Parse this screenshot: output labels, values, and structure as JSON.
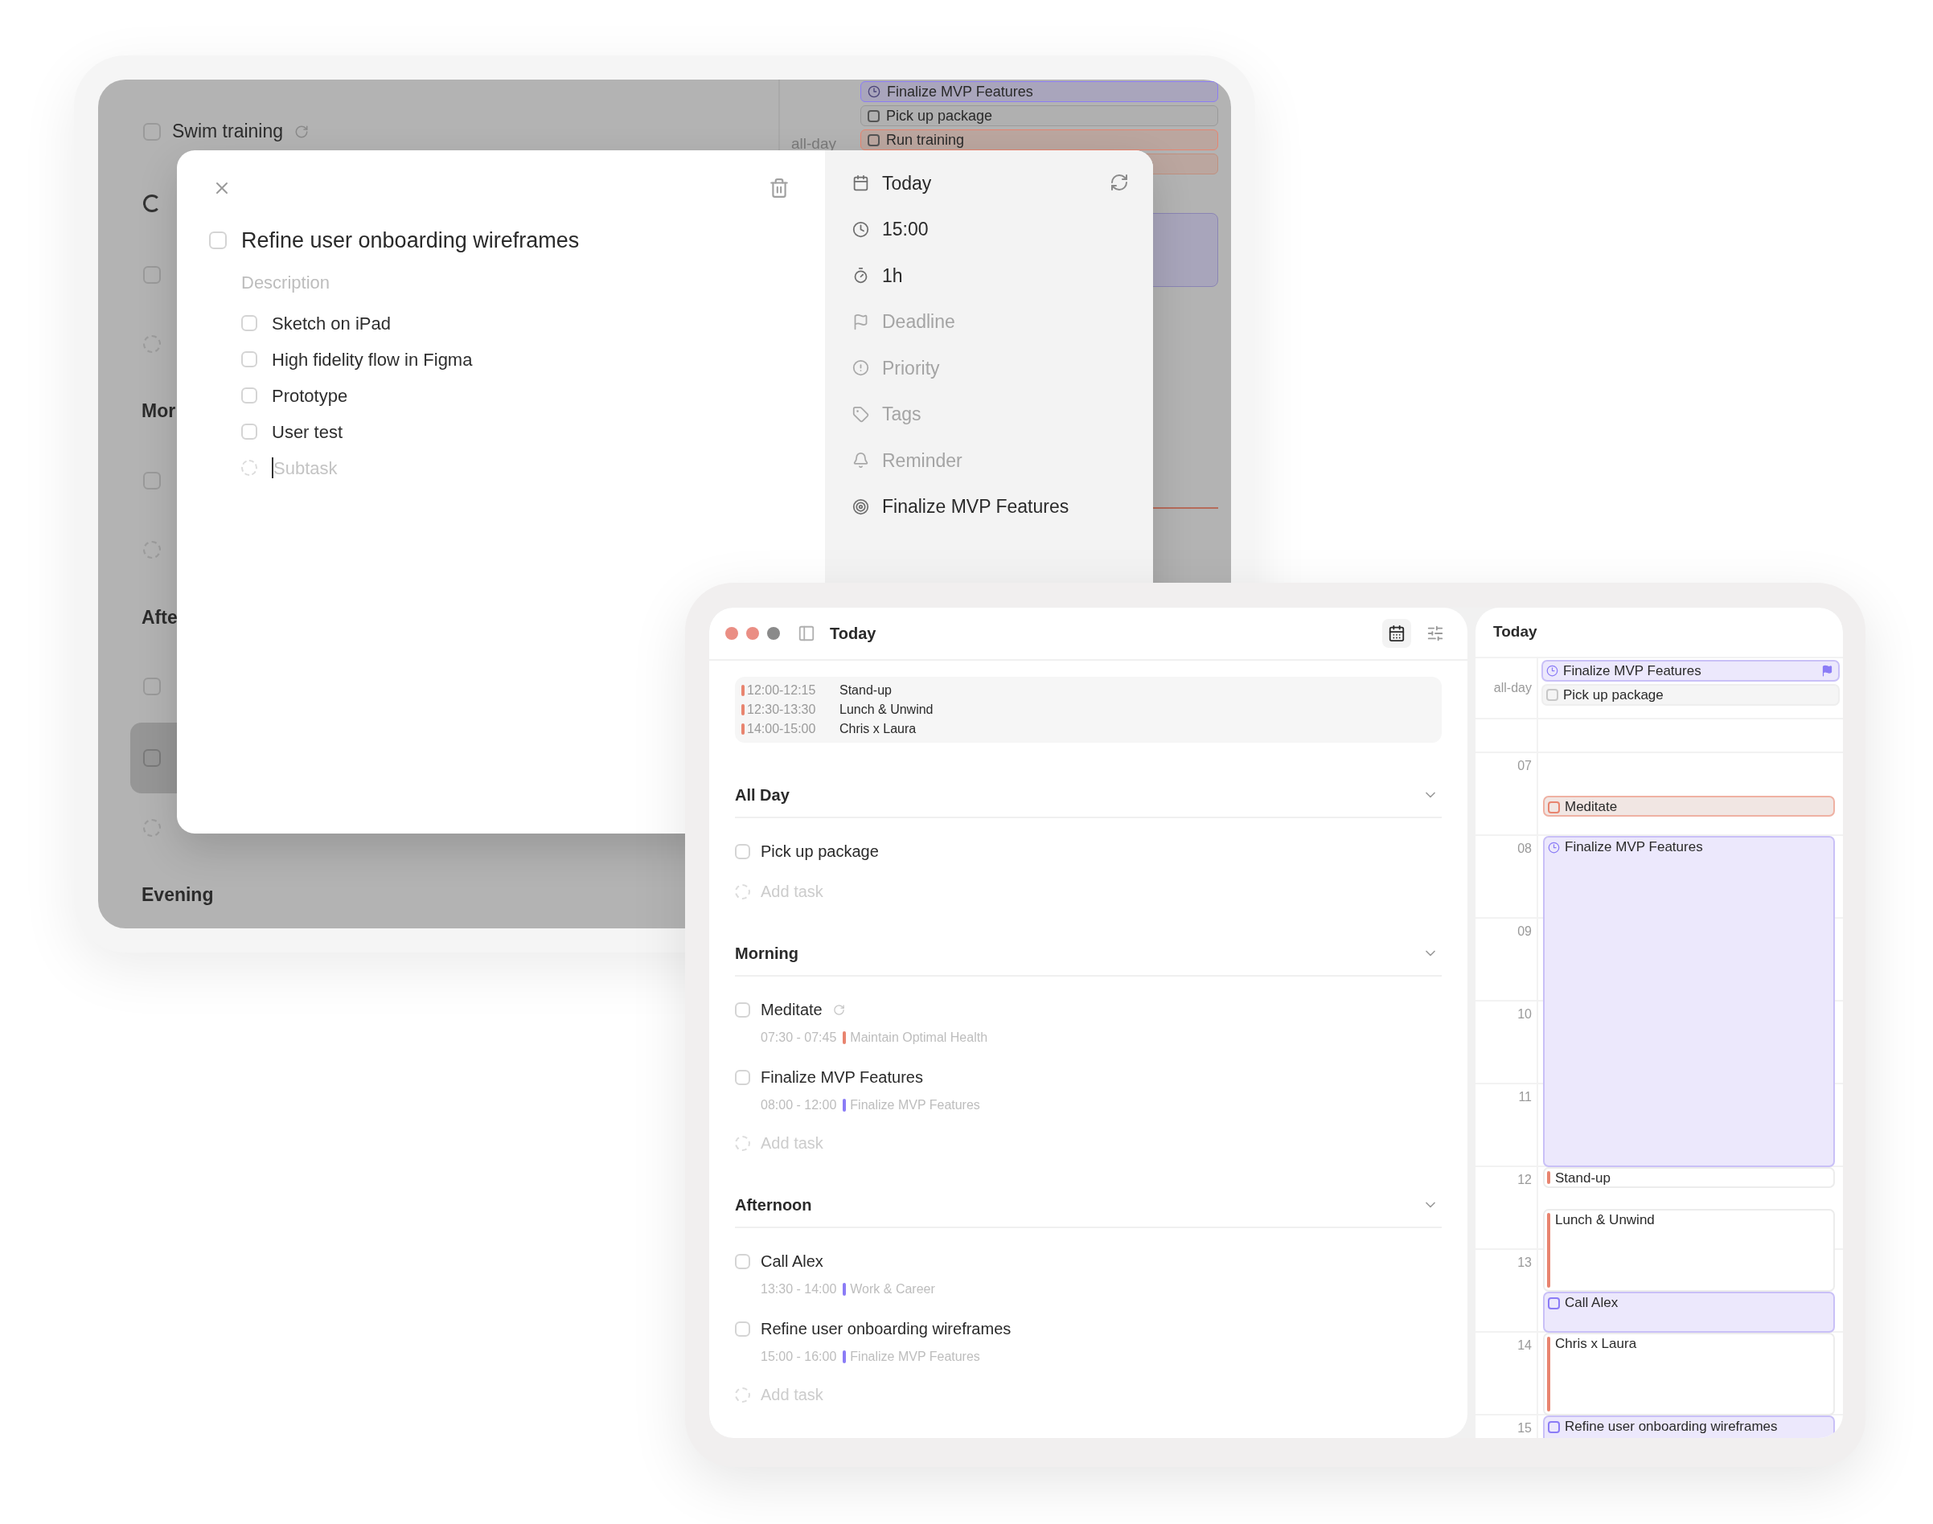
{
  "back_window": {
    "list": [
      {
        "kind": "task",
        "title": "Swim training",
        "checked": false,
        "selected": false
      },
      {
        "kind": "progress"
      },
      {
        "kind": "task",
        "checked": false,
        "selected": false
      },
      {
        "kind": "add"
      },
      {
        "kind": "heading",
        "title": "Mor"
      },
      {
        "kind": "task",
        "checked": false,
        "selected": false
      },
      {
        "kind": "add"
      },
      {
        "kind": "heading",
        "title": "Afte"
      },
      {
        "kind": "task",
        "checked": false,
        "selected": false
      },
      {
        "kind": "task",
        "checked": false,
        "selected": true
      },
      {
        "kind": "add"
      },
      {
        "kind": "heading",
        "title": "Evening"
      }
    ],
    "calendar": {
      "all_day_label": "all-day",
      "events": [
        {
          "kind": "goal",
          "title": "Finalize MVP Features",
          "color": "#8b7cf6"
        },
        {
          "kind": "task",
          "title": "Pick up package",
          "color": "#9a9a9a"
        },
        {
          "kind": "habit",
          "title": "Run training",
          "color": "#e8846f"
        }
      ]
    }
  },
  "task_dialog": {
    "title": "Refine user onboarding wireframes",
    "checked": false,
    "description_placeholder": "Description",
    "subtasks": [
      {
        "title": "Sketch on iPad",
        "checked": false
      },
      {
        "title": "High fidelity flow in Figma",
        "checked": false
      },
      {
        "title": "Prototype",
        "checked": false
      },
      {
        "title": "User test",
        "checked": false
      }
    ],
    "subtask_placeholder": "Subtask",
    "properties": [
      {
        "kind": "date",
        "label": "Today",
        "set": true
      },
      {
        "kind": "time",
        "label": "15:00",
        "set": true
      },
      {
        "kind": "duration",
        "label": "1h",
        "set": true
      },
      {
        "kind": "deadline",
        "label": "Deadline",
        "set": false
      },
      {
        "kind": "priority",
        "label": "Priority",
        "set": false
      },
      {
        "kind": "tags",
        "label": "Tags",
        "set": false
      },
      {
        "kind": "reminder",
        "label": "Reminder",
        "set": false
      },
      {
        "kind": "goal",
        "label": "Finalize MVP Features",
        "set": true
      }
    ]
  },
  "front_window": {
    "title": "Today",
    "calendar_view_selected": true,
    "schedule": [
      {
        "time": "12:00-12:15",
        "title": "Stand-up",
        "color": "#e8846f"
      },
      {
        "time": "12:30-13:30",
        "title": "Lunch & Unwind",
        "color": "#e8846f"
      },
      {
        "time": "14:00-15:00",
        "title": "Chris x Laura",
        "color": "#e8846f"
      }
    ],
    "sections": [
      {
        "title": "All Day",
        "expanded": true,
        "tasks": [
          {
            "title": "Pick up package",
            "checked": false
          }
        ],
        "add_placeholder": "Add task"
      },
      {
        "title": "Morning",
        "expanded": true,
        "tasks": [
          {
            "title": "Meditate",
            "checked": false,
            "repeat": true,
            "time": "07:30 - 07:45",
            "goal": "Maintain Optimal Health",
            "color": "#e8846f"
          },
          {
            "title": "Finalize MVP Features",
            "checked": false,
            "repeat": false,
            "time": "08:00 - 12:00",
            "goal": "Finalize MVP Features",
            "color": "#8b7cf6"
          }
        ],
        "add_placeholder": "Add task"
      },
      {
        "title": "Afternoon",
        "expanded": true,
        "tasks": [
          {
            "title": "Call Alex",
            "checked": false,
            "repeat": false,
            "time": "13:30 - 14:00",
            "goal": "Work & Career",
            "color": "#8b7cf6"
          },
          {
            "title": "Refine user onboarding wireframes",
            "checked": false,
            "repeat": false,
            "time": "15:00 - 16:00",
            "goal": "Finalize MVP Features",
            "color": "#8b7cf6"
          }
        ],
        "add_placeholder": "Add task"
      }
    ],
    "calendar": {
      "title": "Today",
      "all_day_label": "all-day",
      "all_day": [
        {
          "kind": "goal",
          "title": "Finalize MVP Features",
          "color": "#8b7cf6",
          "flagged": true
        },
        {
          "kind": "task",
          "title": "Pick up package",
          "color": "#c8c8c8",
          "flagged": false
        }
      ],
      "hours": [
        "07",
        "08",
        "09",
        "10",
        "11",
        "12",
        "13",
        "14",
        "15"
      ],
      "events": [
        {
          "kind": "habit",
          "title": "Meditate",
          "color": "#e8846f"
        },
        {
          "kind": "goal",
          "title": "Finalize MVP Features",
          "color": "#8b7cf6"
        },
        {
          "kind": "event",
          "title": "Stand-up",
          "color": "#e8846f"
        },
        {
          "kind": "event",
          "title": "Lunch & Unwind",
          "color": "#e8846f"
        },
        {
          "kind": "task",
          "title": "Call Alex",
          "color": "#8b7cf6"
        },
        {
          "kind": "event",
          "title": "Chris x Laura",
          "color": "#e8846f"
        },
        {
          "kind": "task",
          "title": "Refine user onboarding wireframes",
          "color": "#8b7cf6"
        }
      ]
    }
  }
}
